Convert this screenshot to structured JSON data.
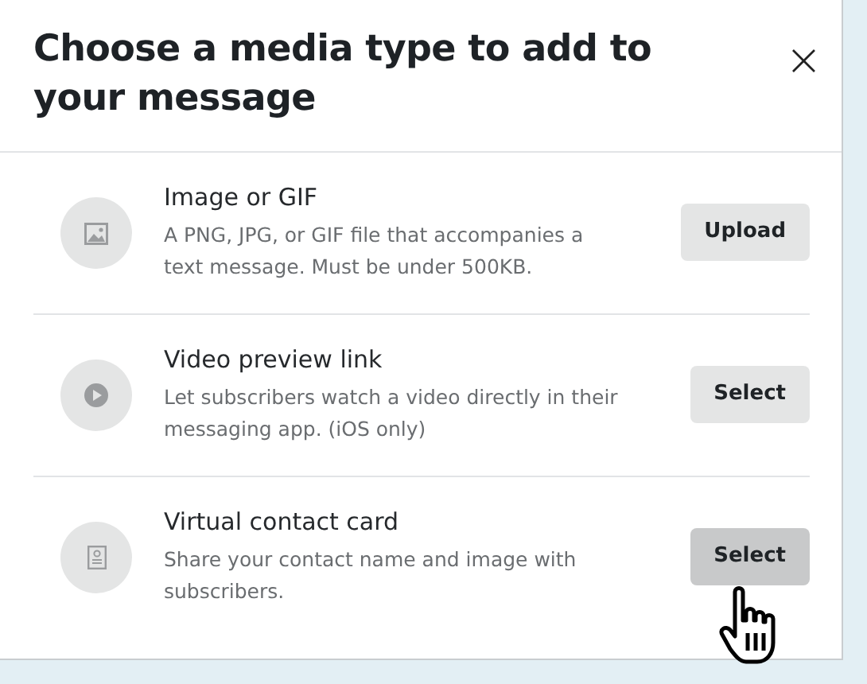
{
  "dialog": {
    "title": "Choose a media type to add to your message",
    "close": "×"
  },
  "options": [
    {
      "kind": "image",
      "title": "Image or GIF",
      "description": "A PNG, JPG, or GIF file that accompanies a text message. Must be under 500KB.",
      "button": "Upload",
      "hovered": false
    },
    {
      "kind": "video",
      "title": "Video preview link",
      "description": "Let subscribers watch a video directly in their messaging app. (iOS only)",
      "button": "Select",
      "hovered": false
    },
    {
      "kind": "contact",
      "title": "Virtual contact card",
      "description": "Share your contact name and image with subscribers.",
      "button": "Select",
      "hovered": true
    }
  ]
}
